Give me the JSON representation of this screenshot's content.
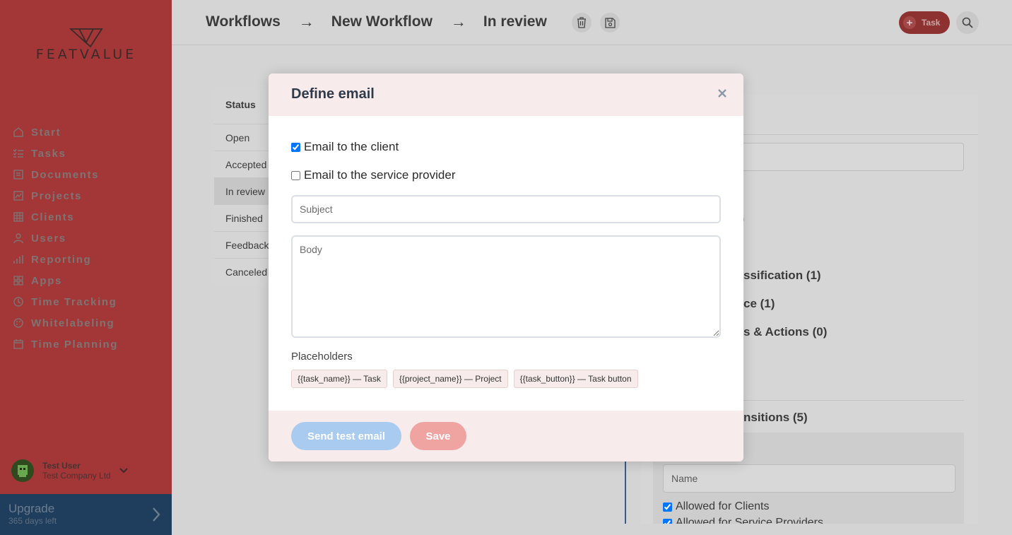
{
  "sidebar": {
    "logo_text": "FEATVALUE",
    "nav": [
      {
        "label": "Start",
        "icon": "home-icon"
      },
      {
        "label": "Tasks",
        "icon": "tasks-icon"
      },
      {
        "label": "Documents",
        "icon": "documents-icon"
      },
      {
        "label": "Projects",
        "icon": "projects-icon"
      },
      {
        "label": "Clients",
        "icon": "clients-icon"
      },
      {
        "label": "Users",
        "icon": "users-icon"
      },
      {
        "label": "Reporting",
        "icon": "reporting-icon"
      },
      {
        "label": "Apps",
        "icon": "apps-icon"
      },
      {
        "label": "Time Tracking",
        "icon": "time-tracking-icon"
      },
      {
        "label": "Whitelabeling",
        "icon": "whitelabeling-icon"
      },
      {
        "label": "Time Planning",
        "icon": "time-planning-icon"
      }
    ],
    "user": {
      "name": "Test User",
      "company": "Test Company Ltd"
    },
    "upgrade": {
      "title": "Upgrade",
      "subtitle": "365 days left"
    }
  },
  "header": {
    "breadcrumbs": [
      "Workflows",
      "New Workflow",
      "In review"
    ],
    "separator": "→",
    "task_button_label": "Task"
  },
  "background": {
    "status": {
      "heading": "Status",
      "items": [
        "Open",
        "Accepted",
        "In review",
        "Finished",
        "Feedback",
        "Canceled"
      ],
      "active": "In review"
    },
    "right_panel": {
      "partial_texts": {
        "count_0": "0)",
        "classification": "ssification (1)",
        "service": "ce (1)",
        "actions": "s & Actions (0)",
        "transitions": "nsitions (5)"
      },
      "name_placeholder": "Name",
      "allowed_clients": "Allowed for Clients",
      "allowed_providers": "Allowed for Service Providers"
    }
  },
  "modal": {
    "title": "Define email",
    "checkbox_client": {
      "label": "Email to the client",
      "checked": true
    },
    "checkbox_provider": {
      "label": "Email to the service provider",
      "checked": false
    },
    "subject_placeholder": "Subject",
    "body_placeholder": "Body",
    "placeholders_label": "Placeholders",
    "placeholders": [
      "{{task_name}} — Task",
      "{{project_name}} — Project",
      "{{task_button}} — Task button"
    ],
    "send_test_label": "Send test email",
    "save_label": "Save"
  },
  "colors": {
    "sidebar_bg": "#a33636",
    "upgrade_bg": "#1f3d5c",
    "modal_header_bg": "#f7eceb",
    "send_test_bg": "#a9cbef",
    "save_bg": "#f0a4a2"
  }
}
